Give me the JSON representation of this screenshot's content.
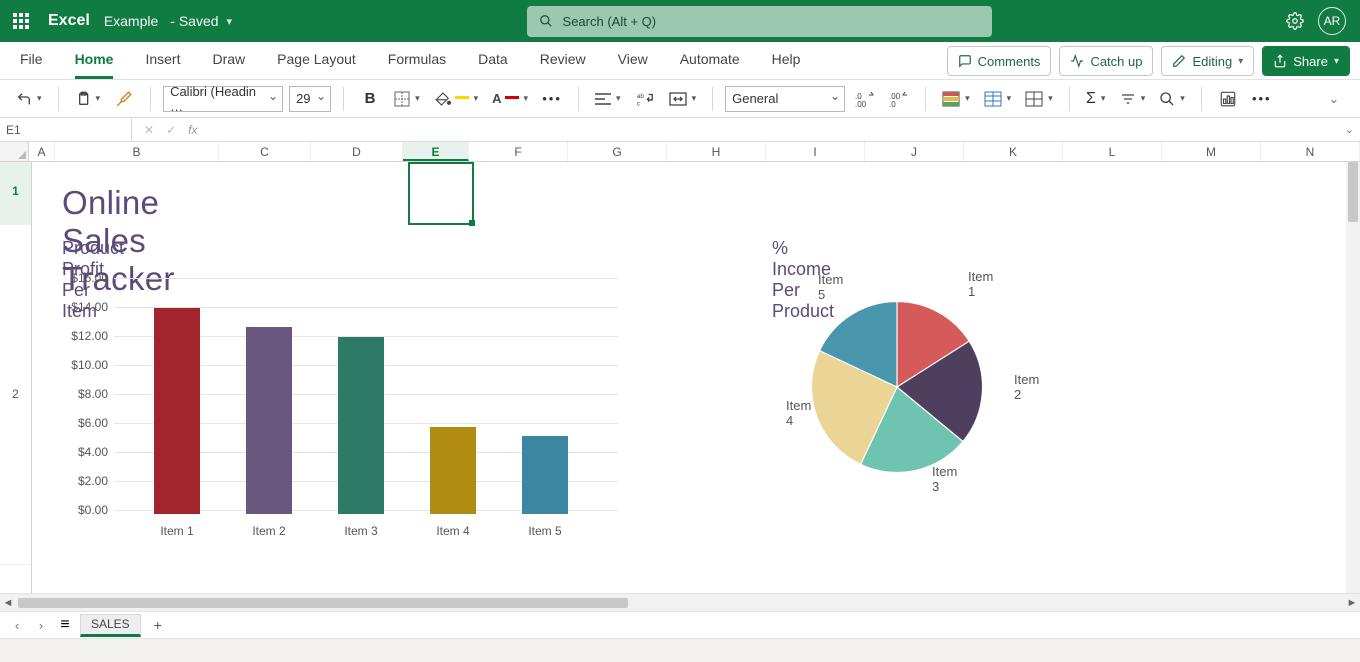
{
  "title": {
    "app": "Excel",
    "doc": "Example",
    "status": "- Saved"
  },
  "search": {
    "placeholder": "Search (Alt + Q)"
  },
  "user": {
    "avatar": "AR"
  },
  "tabs": [
    "File",
    "Home",
    "Insert",
    "Draw",
    "Page Layout",
    "Formulas",
    "Data",
    "Review",
    "View",
    "Automate",
    "Help"
  ],
  "active_tab": 1,
  "action_buttons": {
    "comments": "Comments",
    "catchup": "Catch up",
    "editing": "Editing",
    "share": "Share"
  },
  "ribbon": {
    "font": "Calibri (Headin …",
    "font_size": "29",
    "number_format": "General"
  },
  "formula_bar": {
    "cell_ref": "E1",
    "formula": ""
  },
  "columns": [
    "A",
    "B",
    "C",
    "D",
    "E",
    "F",
    "G",
    "H",
    "I",
    "J",
    "K",
    "L",
    "M",
    "N"
  ],
  "selected_col": "E",
  "rows": [
    "1",
    "2"
  ],
  "sheet": {
    "title": "Online Sales Tracker",
    "bar_title": "Product Profit Per Item",
    "pie_title": "% Income Per Product"
  },
  "chart_data": [
    {
      "type": "bar",
      "title": "Product Profit Per Item",
      "categories": [
        "Item 1",
        "Item 2",
        "Item 3",
        "Item 4",
        "Item 5"
      ],
      "values": [
        14.2,
        12.9,
        12.2,
        6.0,
        5.4
      ],
      "ylabel": "",
      "xlabel": "",
      "ylim": [
        0,
        16
      ],
      "y_ticks": [
        "$16.00",
        "$14.00",
        "$12.00",
        "$10.00",
        "$8.00",
        "$6.00",
        "$4.00",
        "$2.00",
        "$0.00"
      ],
      "colors": [
        "#a2242c",
        "#6a577f",
        "#2d7a67",
        "#b18a12",
        "#3b86a0"
      ]
    },
    {
      "type": "pie",
      "title": "% Income Per Product",
      "categories": [
        "Item 1",
        "Item 2",
        "Item 3",
        "Item 4",
        "Item 5"
      ],
      "values": [
        16,
        20,
        21,
        25,
        18
      ],
      "colors": [
        "#d75a5a",
        "#4f3f5e",
        "#6fc4b0",
        "#ead596",
        "#4997ac"
      ]
    }
  ],
  "sheet_tabs": {
    "active": "SALES"
  }
}
